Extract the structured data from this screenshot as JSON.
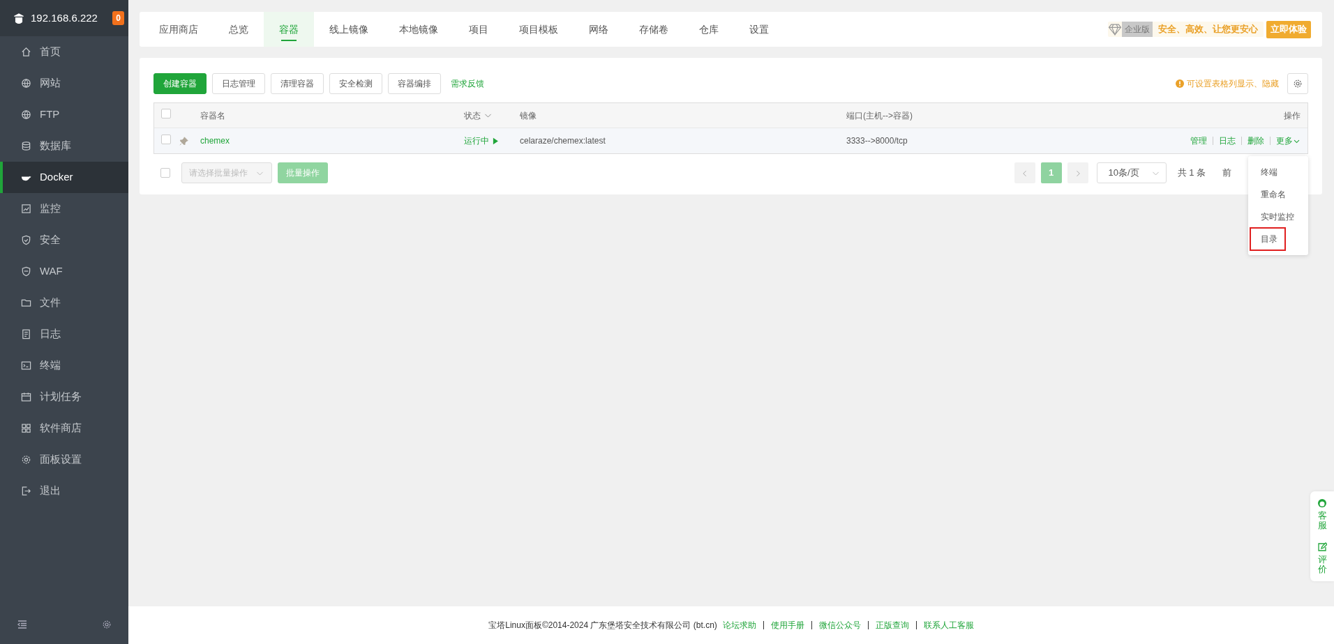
{
  "sidebar": {
    "host": "192.168.6.222",
    "badge": "0",
    "items": [
      {
        "label": "首页",
        "selected": false
      },
      {
        "label": "网站",
        "selected": false
      },
      {
        "label": "FTP",
        "selected": false
      },
      {
        "label": "数据库",
        "selected": false
      },
      {
        "label": "Docker",
        "selected": true
      },
      {
        "label": "监控",
        "selected": false
      },
      {
        "label": "安全",
        "selected": false
      },
      {
        "label": "WAF",
        "selected": false
      },
      {
        "label": "文件",
        "selected": false
      },
      {
        "label": "日志",
        "selected": false
      },
      {
        "label": "终端",
        "selected": false
      },
      {
        "label": "计划任务",
        "selected": false
      },
      {
        "label": "软件商店",
        "selected": false
      },
      {
        "label": "面板设置",
        "selected": false
      },
      {
        "label": "退出",
        "selected": false
      }
    ]
  },
  "tabs": [
    {
      "label": "应用商店",
      "selected": false
    },
    {
      "label": "总览",
      "selected": false
    },
    {
      "label": "容器",
      "selected": true
    },
    {
      "label": "线上镜像",
      "selected": false
    },
    {
      "label": "本地镜像",
      "selected": false
    },
    {
      "label": "项目",
      "selected": false
    },
    {
      "label": "项目模板",
      "selected": false
    },
    {
      "label": "网络",
      "selected": false
    },
    {
      "label": "存储卷",
      "selected": false
    },
    {
      "label": "仓库",
      "selected": false
    },
    {
      "label": "设置",
      "selected": false
    }
  ],
  "promo": {
    "edition": "企业版",
    "slogan": "安全、高效、让您更安心",
    "button": "立即体验"
  },
  "toolbar": {
    "buttons": [
      {
        "label": "创建容器",
        "kind": "primary"
      },
      {
        "label": "日志管理",
        "kind": "default"
      },
      {
        "label": "清理容器",
        "kind": "default"
      },
      {
        "label": "安全检测",
        "kind": "default"
      },
      {
        "label": "容器编排",
        "kind": "default"
      },
      {
        "label": "需求反馈",
        "kind": "link"
      }
    ],
    "hint": "可设置表格列显示、隐藏"
  },
  "table": {
    "select_all_checked": false,
    "columns": [
      "容器名",
      "状态",
      "镜像",
      "端口(主机-->容器)",
      "操作"
    ],
    "rows": [
      {
        "checked": false,
        "name": "chemex",
        "status": "运行中",
        "running": true,
        "image": "celaraze/chemex:latest",
        "ports": "3333-->8000/tcp",
        "actions": [
          "管理",
          "日志",
          "删除",
          "更多"
        ]
      }
    ]
  },
  "batch": {
    "checked": false,
    "placeholder": "请选择批量操作",
    "button": "批量操作"
  },
  "pagination": {
    "pages": [
      {
        "label": "1",
        "selected": true
      }
    ],
    "page_size": "10条/页",
    "total": "共 1 条",
    "jump": "前"
  },
  "dropdown": {
    "items": [
      {
        "label": "终端",
        "highlighted": false
      },
      {
        "label": "重命名",
        "highlighted": false
      },
      {
        "label": "实时监控",
        "highlighted": false
      },
      {
        "label": "目录",
        "highlighted": true
      }
    ]
  },
  "footer": {
    "copyright": "宝塔Linux面板©2014-2024 广东堡塔安全技术有限公司 (bt.cn)",
    "links": [
      "论坛求助",
      "使用手册",
      "微信公众号",
      "正版查询",
      "联系人工客服"
    ]
  },
  "float": {
    "items": [
      "客服",
      "评价"
    ]
  }
}
